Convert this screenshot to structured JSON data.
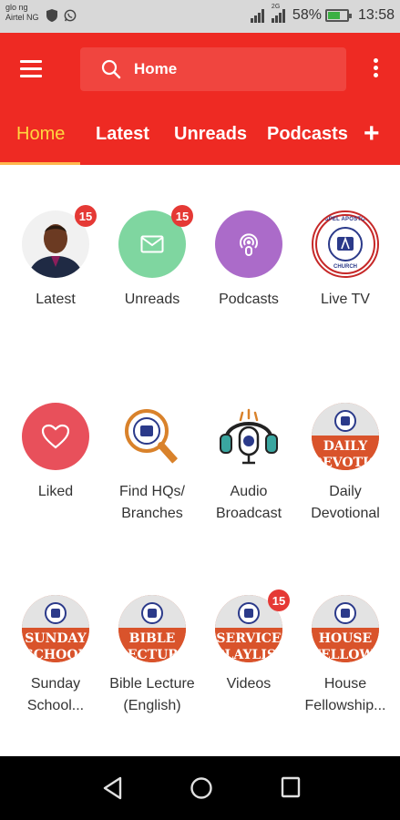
{
  "status_bar": {
    "carrier_line1": "glo ng",
    "carrier_line2": "Airtel NG",
    "network_tag": "2G",
    "battery": "58%",
    "battery_level": 0.58,
    "time": "13:58"
  },
  "header": {
    "search_placeholder": "Home"
  },
  "tabs": [
    {
      "label": "Home",
      "active": true
    },
    {
      "label": "Latest"
    },
    {
      "label": "Unreads"
    },
    {
      "label": "Podcasts"
    }
  ],
  "add_tab_label": "+",
  "grid": {
    "latest": {
      "label": "Latest",
      "badge": "15"
    },
    "unreads": {
      "label": "Unreads",
      "badge": "15"
    },
    "podcasts": {
      "label": "Podcasts"
    },
    "live_tv": {
      "label": "Live TV",
      "logo_text": "GOSPEL APOSTOLIC",
      "logo_sub": "CHURCH"
    },
    "liked": {
      "label": "Liked"
    },
    "find_hqs": {
      "label_line1": "Find HQs/",
      "label_line2": "Branches"
    },
    "audio_broadcast": {
      "label_line1": "Audio",
      "label_line2": "Broadcast"
    },
    "daily_devotional": {
      "label_line1": "Daily",
      "label_line2": "Devotional",
      "band_line1": "DAILY",
      "band_line2": "DEVOTION"
    },
    "sunday_school": {
      "label_line1": "Sunday",
      "label_line2": "School...",
      "band_line1": "SUNDAY",
      "band_line2": "SCHOOL"
    },
    "bible_lecture": {
      "label_line1": "Bible Lecture",
      "label_line2": "(English)",
      "band_line1": "BIBLE",
      "band_line2": "LECTURE"
    },
    "videos": {
      "label": "Videos",
      "badge": "15",
      "band_line1": "SERVICE",
      "band_line2": "PLAYLIST"
    },
    "house_fellowship": {
      "label_line1": "House",
      "label_line2": "Fellowship...",
      "band_line1": "HOUSE",
      "band_line2": "FELLOWSHIP"
    }
  },
  "colors": {
    "primary": "#ee2a23",
    "active_tab": "#ffd740",
    "unreads_circle": "#7fd6a0",
    "podcasts_circle": "#ab6bc9",
    "liked_circle": "#e8505b",
    "badge": "#e53935"
  }
}
